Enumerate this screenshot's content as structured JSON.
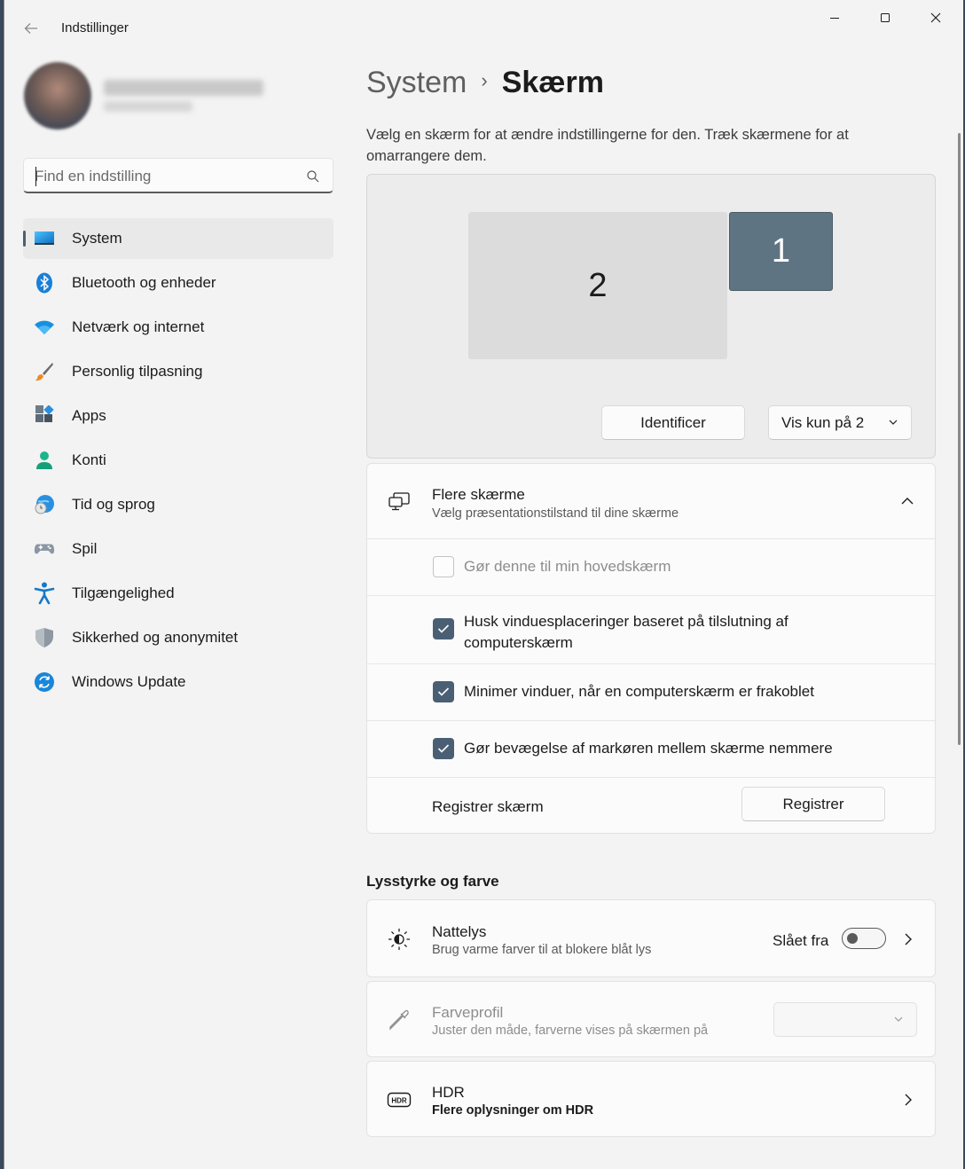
{
  "window": {
    "title": "Indstillinger"
  },
  "search": {
    "placeholder": "Find en indstilling"
  },
  "sidebar": {
    "items": [
      {
        "label": "System",
        "icon": "system-icon",
        "active": true
      },
      {
        "label": "Bluetooth og enheder",
        "icon": "bluetooth-icon"
      },
      {
        "label": "Netværk og internet",
        "icon": "wifi-icon"
      },
      {
        "label": "Personlig tilpasning",
        "icon": "brush-icon"
      },
      {
        "label": "Apps",
        "icon": "apps-icon"
      },
      {
        "label": "Konti",
        "icon": "account-icon"
      },
      {
        "label": "Tid og sprog",
        "icon": "time-language-icon"
      },
      {
        "label": "Spil",
        "icon": "gamepad-icon"
      },
      {
        "label": "Tilgængelighed",
        "icon": "accessibility-icon"
      },
      {
        "label": "Sikkerhed og anonymitet",
        "icon": "shield-icon"
      },
      {
        "label": "Windows Update",
        "icon": "update-icon"
      }
    ]
  },
  "breadcrumb": {
    "parent": "System",
    "separator": "›",
    "current": "Skærm"
  },
  "intro": "Vælg en skærm for at ændre indstillingerne for den. Træk skærmene for at omarrangere dem.",
  "display_arrangement": {
    "monitor_2": "2",
    "monitor_1": "1",
    "identify_label": "Identificer",
    "mode_select_value": "Vis kun på 2"
  },
  "multiple_displays": {
    "title": "Flere skærme",
    "subtitle": "Vælg præsentationstilstand til dine skærme",
    "options": [
      {
        "label": "Gør denne til min hovedskærm",
        "checked": false,
        "disabled": true
      },
      {
        "label": "Husk vinduesplaceringer baseret på tilslutning af computerskærm",
        "checked": true
      },
      {
        "label": "Minimer vinduer, når en computerskærm er frakoblet",
        "checked": true
      },
      {
        "label": "Gør bevægelse af markøren mellem skærme nemmere",
        "checked": true
      }
    ],
    "register_label": "Registrer skærm",
    "register_button": "Registrer"
  },
  "brightness_section": {
    "title": "Lysstyrke og farve",
    "night_light": {
      "title": "Nattelys",
      "subtitle": "Brug varme farver til at blokere blåt lys",
      "status": "Slået fra",
      "on": false
    },
    "color_profile": {
      "title": "Farveprofil",
      "subtitle": "Juster den måde, farverne vises på skærmen på",
      "disabled": true
    },
    "hdr": {
      "title": "HDR",
      "subtitle": "Flere oplysninger om HDR"
    }
  },
  "colors": {
    "accent": "#4a5f73",
    "monitor_selected": "#5f7482",
    "monitor_other": "#dcdcdc"
  }
}
